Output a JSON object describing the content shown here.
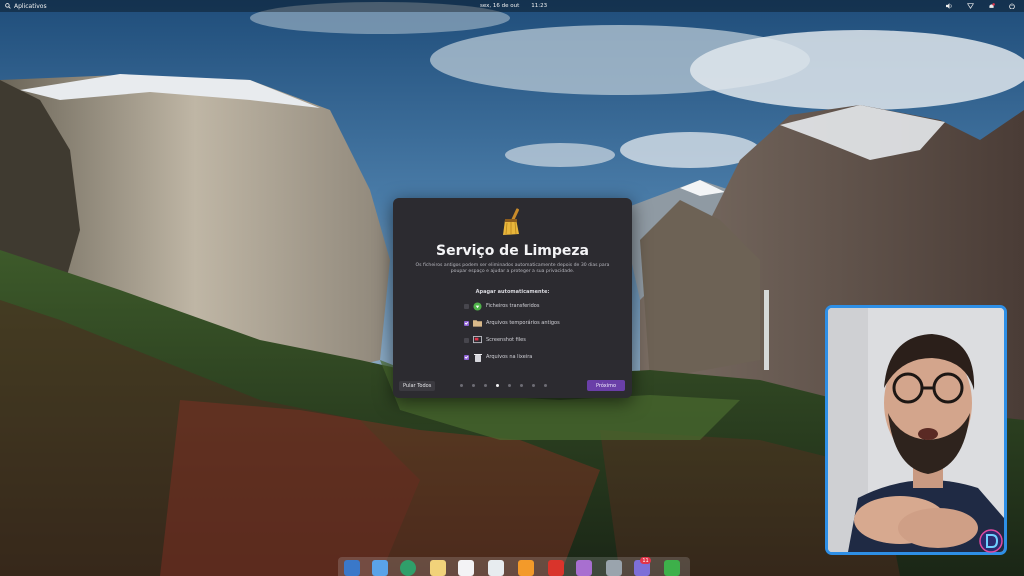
{
  "top_panel": {
    "apps_label": "Aplicativos",
    "date": "sex, 16 de out",
    "time": "11:23",
    "icons": [
      "volume-icon",
      "network-icon",
      "notifications-icon",
      "power-icon"
    ]
  },
  "dialog": {
    "title": "Serviço de Limpeza",
    "description": "Os ficheiros antigos podem ser eliminados automaticamente depois de 30 dias para poupar espaço e ajudar a proteger a sua privacidade.",
    "section_label": "Apagar automaticamente:",
    "options": [
      {
        "label": "Ficheiros transferidos",
        "checked": false,
        "icon": "download-icon"
      },
      {
        "label": "Arquivos temporários antigos",
        "checked": true,
        "icon": "folder-icon"
      },
      {
        "label": "Screenshot files",
        "checked": false,
        "icon": "screenshot-icon"
      },
      {
        "label": "Arquivos na lixeira",
        "checked": true,
        "icon": "trash-icon"
      }
    ],
    "skip_label": "Pular Todos",
    "next_label": "Próximo",
    "pages_total": 8,
    "page_current": 4
  },
  "dock": {
    "items": [
      "files-icon",
      "search-icon",
      "web-browser-icon",
      "mail-icon",
      "tasks-icon",
      "spreadsheet-icon",
      "music-icon",
      "videos-icon",
      "photos-icon",
      "settings-icon",
      "appcenter-icon",
      "checkmark-icon"
    ],
    "appcenter_badge": "11"
  },
  "colors": {
    "accent": "#6a3fa8",
    "dialog_bg": "#2c2b30",
    "webcam_border": "#2e8fe6"
  }
}
